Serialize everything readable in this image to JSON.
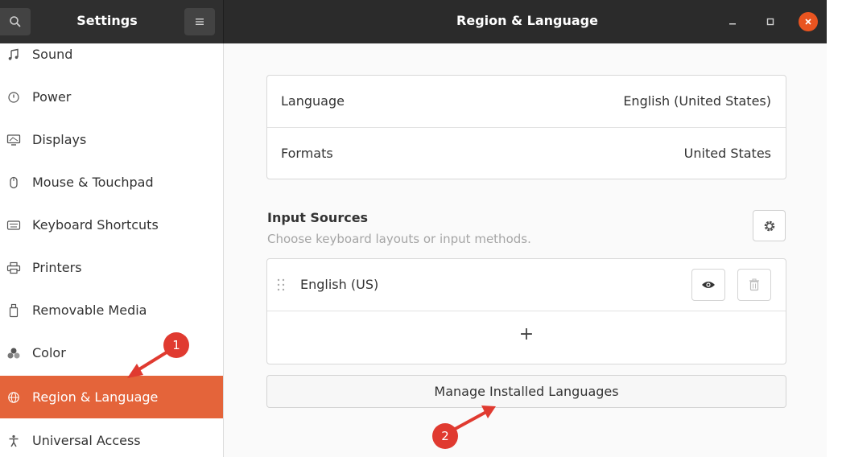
{
  "header": {
    "app_title": "Settings",
    "panel_title": "Region & Language",
    "search_icon": "search-icon",
    "menu_icon": "hamburger-icon"
  },
  "sidebar": {
    "items": [
      {
        "label": "Sound",
        "icon": "music-note-icon",
        "active": false
      },
      {
        "label": "Power",
        "icon": "power-icon",
        "active": false
      },
      {
        "label": "Displays",
        "icon": "display-icon",
        "active": false
      },
      {
        "label": "Mouse & Touchpad",
        "icon": "mouse-icon",
        "active": false
      },
      {
        "label": "Keyboard Shortcuts",
        "icon": "keyboard-icon",
        "active": false
      },
      {
        "label": "Printers",
        "icon": "printer-icon",
        "active": false
      },
      {
        "label": "Removable Media",
        "icon": "removable-media-icon",
        "active": false
      },
      {
        "label": "Color",
        "icon": "color-icon",
        "active": false
      },
      {
        "label": "Region & Language",
        "icon": "globe-icon",
        "active": true
      },
      {
        "label": "Universal Access",
        "icon": "accessibility-icon",
        "active": false
      }
    ],
    "active_color": "#e4643a"
  },
  "main": {
    "language_label": "Language",
    "language_value": "English (United States)",
    "formats_label": "Formats",
    "formats_value": "United States",
    "input_sources_title": "Input Sources",
    "input_sources_subtitle": "Choose keyboard layouts or input methods.",
    "input_source_name": "English (US)",
    "add_symbol": "+",
    "manage_button": "Manage Installed Languages"
  },
  "annotations": {
    "badge_1": "1",
    "badge_2": "2",
    "color": "#e03a30"
  },
  "colors": {
    "accent": "#e95420",
    "headerbar": "#2b2b2b"
  }
}
